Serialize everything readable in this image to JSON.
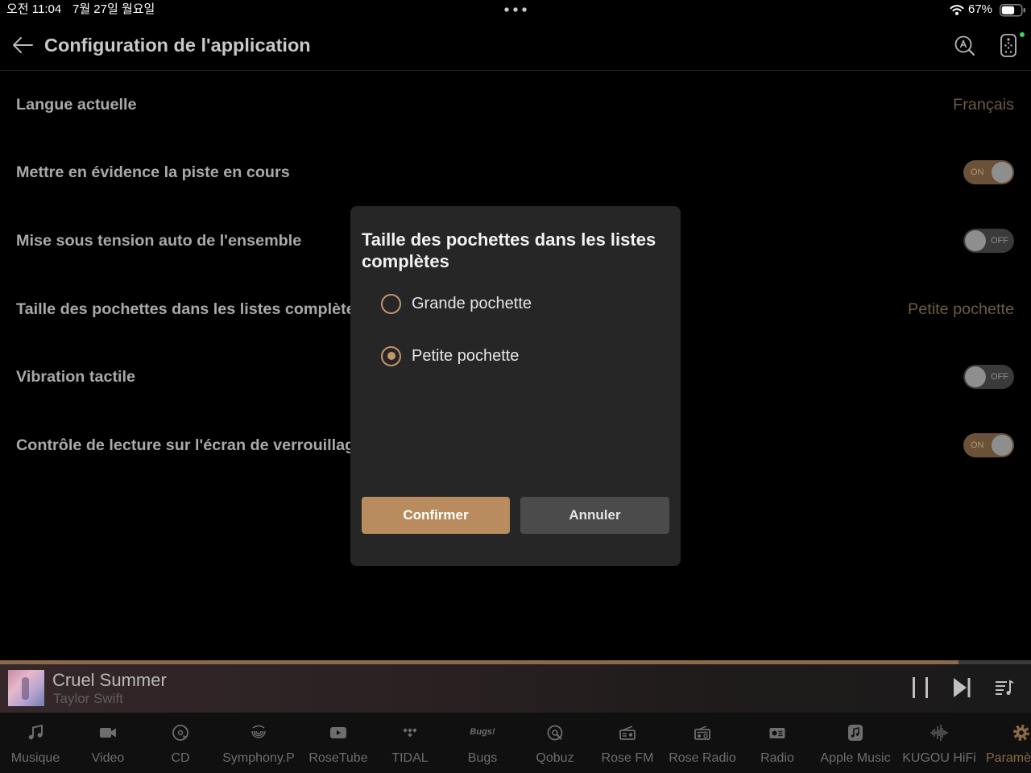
{
  "status_bar": {
    "time": "오전 11:04",
    "date": "7월 27일 월요일",
    "battery": "67%",
    "icons": [
      "multitask-dots-icon",
      "wifi-icon",
      "battery-icon"
    ]
  },
  "header": {
    "title": "Configuration de l'application",
    "icons": [
      "arrow-left-icon",
      "search-a-icon",
      "remote-icon"
    ]
  },
  "settings": [
    {
      "label": "Langue actuelle",
      "value": "Français"
    },
    {
      "label": "Mettre en évidence la piste en cours",
      "toggle": "ON"
    },
    {
      "label": "Mise sous tension auto de l'ensemble",
      "toggle": "OFF"
    },
    {
      "label": "Taille des pochettes dans les listes complète",
      "value": "Petite pochette"
    },
    {
      "label": "Vibration tactile",
      "toggle": "OFF"
    },
    {
      "label": "Contrôle de lecture sur l'écran de verrouillag",
      "toggle": "ON"
    }
  ],
  "dialog": {
    "title": "Taille des pochettes dans les listes complètes",
    "options": [
      {
        "label": "Grande pochette",
        "selected": false
      },
      {
        "label": "Petite pochette",
        "selected": true
      }
    ],
    "confirm_label": "Confirmer",
    "cancel_label": "Annuler"
  },
  "player": {
    "title": "Cruel Summer",
    "artist": "Taylor Swift",
    "progress": 0.93,
    "icons": [
      "pause-icon",
      "next-track-icon",
      "queue-icon"
    ]
  },
  "nav": [
    {
      "label": "Musique",
      "icon": "music-note-icon"
    },
    {
      "label": "Video",
      "icon": "video-camera-icon"
    },
    {
      "label": "CD",
      "icon": "cd-icon"
    },
    {
      "label": "Symphony.P",
      "icon": "symphony-icon"
    },
    {
      "label": "RoseTube",
      "icon": "play-box-icon"
    },
    {
      "label": "TIDAL",
      "icon": "tidal-icon"
    },
    {
      "label": "Bugs",
      "icon": "bugs-logo-icon",
      "logo_text": "Bugs!"
    },
    {
      "label": "Qobuz",
      "icon": "qobuz-icon"
    },
    {
      "label": "Rose FM",
      "icon": "radio-icon"
    },
    {
      "label": "Rose Radio",
      "icon": "radio-icon"
    },
    {
      "label": "Radio",
      "icon": "radio-box-icon"
    },
    {
      "label": "Apple Music",
      "icon": "apple-music-icon"
    },
    {
      "label": "KUGOU HiFi",
      "icon": "waveform-icon"
    },
    {
      "label": "Paramè",
      "icon": "gear-icon",
      "active": true
    }
  ],
  "colors": {
    "accent": "#b88c5e",
    "accent_ring": "#c39569",
    "value_text": "#6e5a43",
    "toggle_on": "#6a5137",
    "toggle_off": "#3a3a3a",
    "progress": "#8a6a4b",
    "active_nav": "#8a6a45",
    "online_dot": "#3ed36b"
  }
}
